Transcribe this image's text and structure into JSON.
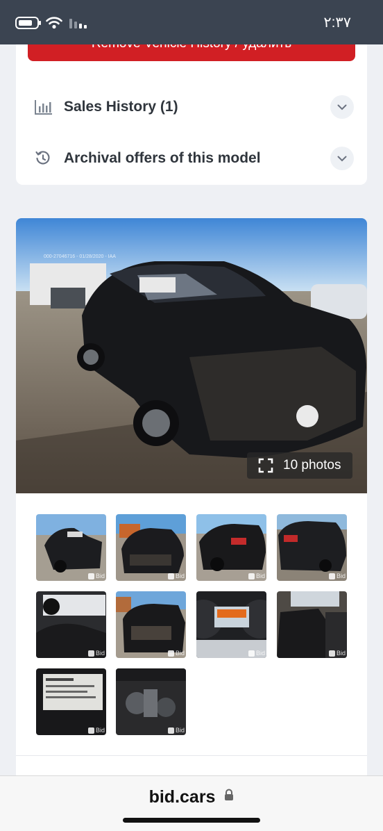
{
  "status_bar": {
    "time": "٢:٣٧"
  },
  "vehicle_card": {
    "remove_history_label": "Remove Vehicle History / удалить",
    "sales_history_label": "Sales History (1)",
    "archival_offers_label": "Archival offers of this model"
  },
  "gallery": {
    "photos_count_label": "10 photos",
    "thumb_watermark": "Bid",
    "overlay_text": "000-27046716 - 01/28/2020 - IAA"
  },
  "browser": {
    "url": "bid.cars"
  },
  "colors": {
    "status_bar": "#3b4451",
    "accent_red": "#d11f24",
    "page_background": "#eef0f4",
    "card_background": "#ffffff"
  }
}
